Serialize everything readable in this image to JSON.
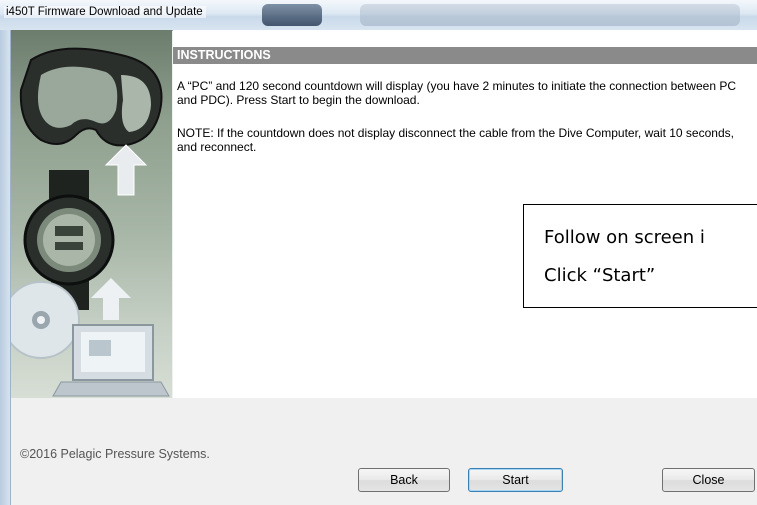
{
  "window": {
    "title": "i450T Firmware Download and Update"
  },
  "instructions": {
    "header": "INSTRUCTIONS",
    "paragraph1": "A “PC” and 120 second countdown will display (you have 2 minutes to initiate the connection between PC and PDC). Press Start to begin the download.",
    "paragraph2": "NOTE: If the countdown does not display disconnect the cable from the Dive Computer, wait 10 seconds, and reconnect."
  },
  "callout": {
    "line1": "Follow on screen i",
    "line2": "Click “Start”"
  },
  "footer": {
    "copyright": "©2016 Pelagic Pressure Systems."
  },
  "buttons": {
    "back": "Back",
    "start": "Start",
    "close": "Close"
  },
  "icons": [
    "dive-mask-icon",
    "dive-watch-icon",
    "cd-disc-icon",
    "laptop-icon",
    "up-arrow-icon"
  ]
}
